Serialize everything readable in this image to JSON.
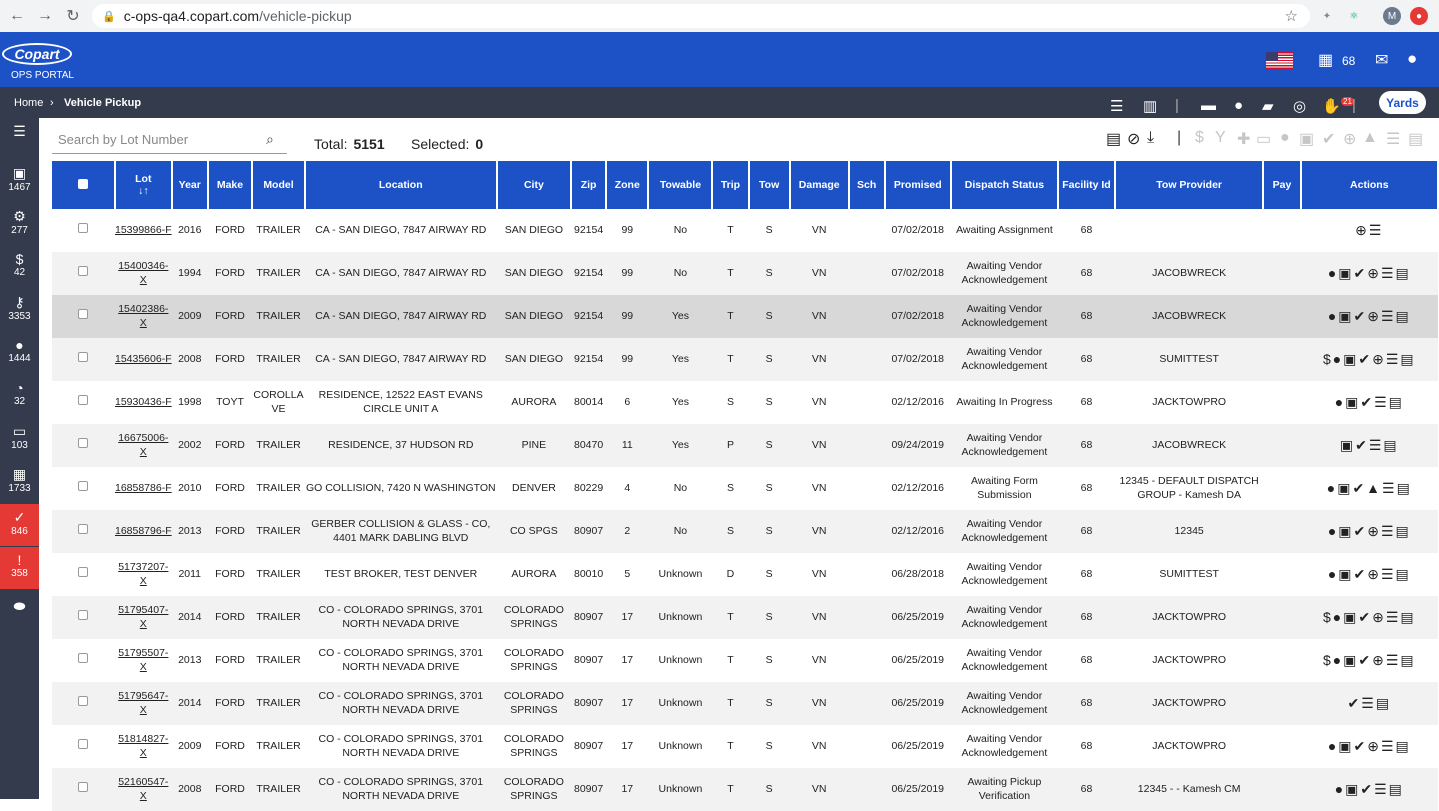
{
  "browser": {
    "url_host": "c-ops-qa4.copart.com",
    "url_path": "/vehicle-pickup",
    "avatar": "M"
  },
  "header": {
    "logo": "Copart",
    "portal": "OPS PORTAL",
    "yard_count": "68"
  },
  "breadcrumb": {
    "home": "Home",
    "current": "Vehicle Pickup",
    "yards_label": "Yards",
    "badge": "21"
  },
  "sidebar": [
    {
      "icon": "filter-icon",
      "count": ""
    },
    {
      "icon": "car-doc-icon",
      "count": "1467"
    },
    {
      "icon": "car-tow-icon",
      "count": "277"
    },
    {
      "icon": "car-dollar-icon",
      "count": "42"
    },
    {
      "icon": "car-key-icon",
      "count": "3353"
    },
    {
      "icon": "pin-icon",
      "count": "1444"
    },
    {
      "icon": "clock-icon",
      "count": "32"
    },
    {
      "icon": "bus-icon",
      "count": "103"
    },
    {
      "icon": "calendar-icon",
      "count": "1733"
    },
    {
      "icon": "check-icon",
      "count": "846"
    },
    {
      "icon": "alert-icon",
      "count": "358"
    },
    {
      "icon": "toggle-icon",
      "count": ""
    }
  ],
  "search": {
    "placeholder": "Search by Lot Number"
  },
  "summary": {
    "total_label": "Total:",
    "total": "5151",
    "selected_label": "Selected:",
    "selected": "0"
  },
  "columns": [
    "Lot",
    "Year",
    "Make",
    "Model",
    "Location",
    "City",
    "Zip",
    "Zone",
    "Towable",
    "Trip",
    "Tow",
    "Damage",
    "Sch",
    "Promised",
    "Dispatch Status",
    "Facility Id",
    "Tow Provider",
    "Pay",
    "Actions"
  ],
  "rows": [
    {
      "lot": "15399866-F",
      "year": "2016",
      "make": "FORD",
      "model": "TRAILER",
      "location": "CA - SAN DIEGO, 7847 AIRWAY RD",
      "city": "SAN DIEGO",
      "zip": "92154",
      "zone": "99",
      "towable": "No",
      "trip": "T",
      "tow": "S",
      "damage": "VN",
      "sch": "",
      "promised": "07/02/2018",
      "status": "Awaiting Assignment",
      "facility": "68",
      "provider": "",
      "pay": "",
      "actions": "⊕☰"
    },
    {
      "lot": "15400346-X",
      "year": "1994",
      "make": "FORD",
      "model": "TRAILER",
      "location": "CA - SAN DIEGO, 7847 AIRWAY RD",
      "city": "SAN DIEGO",
      "zip": "92154",
      "zone": "99",
      "towable": "No",
      "trip": "T",
      "tow": "S",
      "damage": "VN",
      "sch": "",
      "promised": "07/02/2018",
      "status": "Awaiting Vendor Acknowledgement",
      "facility": "68",
      "provider": "JACOBWRECK",
      "pay": "",
      "actions": "●▣✔⊕☰▤"
    },
    {
      "lot": "15402386-X",
      "year": "2009",
      "make": "FORD",
      "model": "TRAILER",
      "location": "CA - SAN DIEGO, 7847 AIRWAY RD",
      "city": "SAN DIEGO",
      "zip": "92154",
      "zone": "99",
      "towable": "Yes",
      "trip": "T",
      "tow": "S",
      "damage": "VN",
      "sch": "",
      "promised": "07/02/2018",
      "status": "Awaiting Vendor Acknowledgement",
      "facility": "68",
      "provider": "JACOBWRECK",
      "pay": "",
      "actions": "●▣✔⊕☰▤"
    },
    {
      "lot": "15435606-F",
      "year": "2008",
      "make": "FORD",
      "model": "TRAILER",
      "location": "CA - SAN DIEGO, 7847 AIRWAY RD",
      "city": "SAN DIEGO",
      "zip": "92154",
      "zone": "99",
      "towable": "Yes",
      "trip": "T",
      "tow": "S",
      "damage": "VN",
      "sch": "",
      "promised": "07/02/2018",
      "status": "Awaiting Vendor Acknowledgement",
      "facility": "68",
      "provider": "SUMITTEST",
      "pay": "",
      "actions": "$●▣✔⊕☰▤"
    },
    {
      "lot": "15930436-F",
      "year": "1998",
      "make": "TOYT",
      "model": "COROLLA VE",
      "location": "RESIDENCE, 12522 EAST EVANS CIRCLE UNIT A",
      "city": "AURORA",
      "zip": "80014",
      "zone": "6",
      "towable": "Yes",
      "trip": "S",
      "tow": "S",
      "damage": "VN",
      "sch": "",
      "promised": "02/12/2016",
      "status": "Awaiting In Progress",
      "facility": "68",
      "provider": "JACKTOWPRO",
      "pay": "",
      "actions": "●▣✔☰▤"
    },
    {
      "lot": "16675006-X",
      "year": "2002",
      "make": "FORD",
      "model": "TRAILER",
      "location": "RESIDENCE, 37 HUDSON RD",
      "city": "PINE",
      "zip": "80470",
      "zone": "11",
      "towable": "Yes",
      "trip": "P",
      "tow": "S",
      "damage": "VN",
      "sch": "",
      "promised": "09/24/2019",
      "status": "Awaiting Vendor Acknowledgement",
      "facility": "68",
      "provider": "JACOBWRECK",
      "pay": "",
      "actions": "▣✔☰▤"
    },
    {
      "lot": "16858786-F",
      "year": "2010",
      "make": "FORD",
      "model": "TRAILER",
      "location": "GO COLLISION, 7420 N WASHINGTON",
      "city": "DENVER",
      "zip": "80229",
      "zone": "4",
      "towable": "No",
      "trip": "S",
      "tow": "S",
      "damage": "VN",
      "sch": "",
      "promised": "02/12/2016",
      "status": "Awaiting Form Submission",
      "facility": "68",
      "provider": "12345 - DEFAULT DISPATCH GROUP - Kamesh DA",
      "pay": "",
      "actions": "●▣✔▲☰▤"
    },
    {
      "lot": "16858796-F",
      "year": "2013",
      "make": "FORD",
      "model": "TRAILER",
      "location": "GERBER COLLISION & GLASS - CO, 4401 MARK DABLING BLVD",
      "city": "CO SPGS",
      "zip": "80907",
      "zone": "2",
      "towable": "No",
      "trip": "S",
      "tow": "S",
      "damage": "VN",
      "sch": "",
      "promised": "02/12/2016",
      "status": "Awaiting Vendor Acknowledgement",
      "facility": "68",
      "provider": "12345",
      "pay": "",
      "actions": "●▣✔⊕☰▤"
    },
    {
      "lot": "51737207-X",
      "year": "2011",
      "make": "FORD",
      "model": "TRAILER",
      "location": "TEST BROKER, TEST DENVER",
      "city": "AURORA",
      "zip": "80010",
      "zone": "5",
      "towable": "Unknown",
      "trip": "D",
      "tow": "S",
      "damage": "VN",
      "sch": "",
      "promised": "06/28/2018",
      "status": "Awaiting Vendor Acknowledgement",
      "facility": "68",
      "provider": "SUMITTEST",
      "pay": "",
      "actions": "●▣✔⊕☰▤"
    },
    {
      "lot": "51795407-X",
      "year": "2014",
      "make": "FORD",
      "model": "TRAILER",
      "location": "CO - COLORADO SPRINGS, 3701 NORTH NEVADA DRIVE",
      "city": "COLORADO SPRINGS",
      "zip": "80907",
      "zone": "17",
      "towable": "Unknown",
      "trip": "T",
      "tow": "S",
      "damage": "VN",
      "sch": "",
      "promised": "06/25/2019",
      "status": "Awaiting Vendor Acknowledgement",
      "facility": "68",
      "provider": "JACKTOWPRO",
      "pay": "",
      "actions": "$●▣✔⊕☰▤"
    },
    {
      "lot": "51795507-X",
      "year": "2013",
      "make": "FORD",
      "model": "TRAILER",
      "location": "CO - COLORADO SPRINGS, 3701 NORTH NEVADA DRIVE",
      "city": "COLORADO SPRINGS",
      "zip": "80907",
      "zone": "17",
      "towable": "Unknown",
      "trip": "T",
      "tow": "S",
      "damage": "VN",
      "sch": "",
      "promised": "06/25/2019",
      "status": "Awaiting Vendor Acknowledgement",
      "facility": "68",
      "provider": "JACKTOWPRO",
      "pay": "",
      "actions": "$●▣✔⊕☰▤"
    },
    {
      "lot": "51795647-X",
      "year": "2014",
      "make": "FORD",
      "model": "TRAILER",
      "location": "CO - COLORADO SPRINGS, 3701 NORTH NEVADA DRIVE",
      "city": "COLORADO SPRINGS",
      "zip": "80907",
      "zone": "17",
      "towable": "Unknown",
      "trip": "T",
      "tow": "S",
      "damage": "VN",
      "sch": "",
      "promised": "06/25/2019",
      "status": "Awaiting Vendor Acknowledgement",
      "facility": "68",
      "provider": "JACKTOWPRO",
      "pay": "",
      "actions": "✔☰▤"
    },
    {
      "lot": "51814827-X",
      "year": "2009",
      "make": "FORD",
      "model": "TRAILER",
      "location": "CO - COLORADO SPRINGS, 3701 NORTH NEVADA DRIVE",
      "city": "COLORADO SPRINGS",
      "zip": "80907",
      "zone": "17",
      "towable": "Unknown",
      "trip": "T",
      "tow": "S",
      "damage": "VN",
      "sch": "",
      "promised": "06/25/2019",
      "status": "Awaiting Vendor Acknowledgement",
      "facility": "68",
      "provider": "JACKTOWPRO",
      "pay": "",
      "actions": "●▣✔⊕☰▤"
    },
    {
      "lot": "52160547-X",
      "year": "2008",
      "make": "FORD",
      "model": "TRAILER",
      "location": "CO - COLORADO SPRINGS, 3701 NORTH NEVADA DRIVE",
      "city": "COLORADO SPRINGS",
      "zip": "80907",
      "zone": "17",
      "towable": "Unknown",
      "trip": "T",
      "tow": "S",
      "damage": "VN",
      "sch": "",
      "promised": "06/25/2019",
      "status": "Awaiting Pickup Verification",
      "facility": "68",
      "provider": "12345 - - Kamesh CM",
      "pay": "",
      "actions": "●▣✔☰▤"
    }
  ],
  "colors": {
    "primary": "#1d52c7",
    "sidebar": "#343b4d",
    "alert": "#e53935"
  }
}
